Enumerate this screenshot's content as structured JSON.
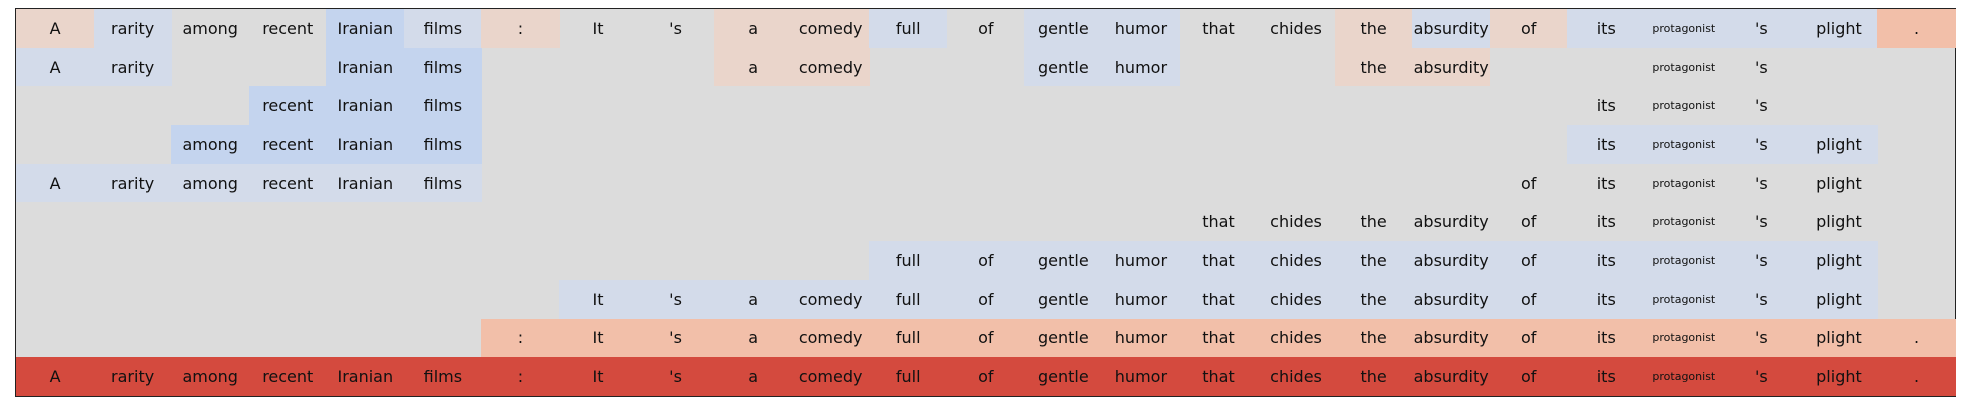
{
  "chart_data": {
    "type": "heatmap",
    "colors": {
      "background": "#dcdcdc",
      "r": "#d44a3e",
      "o": "#f2bfa9",
      "p": "#ead5cb",
      "b": "#c4d4ee",
      "l": "#d3dbea"
    },
    "tokens": [
      "A",
      "rarity",
      "among",
      "recent",
      "Iranian",
      "films",
      ":",
      "It",
      "'s",
      "a",
      "comedy",
      "full",
      "of",
      "gentle",
      "humor",
      "that",
      "chides",
      "the",
      "absurdity",
      "of",
      "its",
      "protagonist",
      "'s",
      "plight",
      "."
    ],
    "rows": [
      {
        "words": [
          "A",
          "rarity",
          "among",
          "recent",
          "Iranian",
          "films",
          ":",
          "It",
          "'s",
          "a",
          "comedy",
          "full",
          "of",
          "gentle",
          "humor",
          "that",
          "chides",
          "the",
          "absurdity",
          "of",
          "its",
          "protagonist",
          "'s",
          "plight",
          "."
        ],
        "shades": [
          "p",
          "l",
          "",
          "",
          "b",
          "l",
          "p",
          "",
          "",
          "p",
          "p",
          "l",
          "",
          "l",
          "l",
          "",
          "",
          "p",
          "l",
          "p",
          "l",
          "l",
          "l",
          "l",
          "o"
        ]
      },
      {
        "words": [
          "A",
          "rarity",
          "",
          "",
          "Iranian",
          "films",
          "",
          "",
          "",
          "a",
          "comedy",
          "",
          "",
          "gentle",
          "humor",
          "",
          "",
          "the",
          "absurdity",
          "",
          "",
          "protagonist",
          "'s",
          "",
          ""
        ],
        "shades": [
          "l",
          "l",
          "",
          "",
          "b",
          "b",
          "",
          "",
          "",
          "p",
          "p",
          "",
          "",
          "l",
          "l",
          "",
          "",
          "p",
          "p",
          "",
          "",
          "",
          "",
          "",
          ""
        ]
      },
      {
        "words": [
          "",
          "",
          "",
          "recent",
          "Iranian",
          "films",
          "",
          "",
          "",
          "",
          "",
          "",
          "",
          "",
          "",
          "",
          "",
          "",
          "",
          "",
          "its",
          "protagonist",
          "'s",
          "",
          ""
        ],
        "shades": [
          "",
          "",
          "",
          "b",
          "b",
          "b",
          "",
          "",
          "",
          "",
          "",
          "",
          "",
          "",
          "",
          "",
          "",
          "",
          "",
          "",
          "",
          "",
          "",
          "",
          ""
        ]
      },
      {
        "words": [
          "",
          "",
          "among",
          "recent",
          "Iranian",
          "films",
          "",
          "",
          "",
          "",
          "",
          "",
          "",
          "",
          "",
          "",
          "",
          "",
          "",
          "",
          "its",
          "protagonist",
          "'s",
          "plight",
          ""
        ],
        "shades": [
          "",
          "",
          "b",
          "b",
          "b",
          "b",
          "",
          "",
          "",
          "",
          "",
          "",
          "",
          "",
          "",
          "",
          "",
          "",
          "",
          "",
          "l",
          "l",
          "l",
          "l",
          ""
        ]
      },
      {
        "words": [
          "A",
          "rarity",
          "among",
          "recent",
          "Iranian",
          "films",
          "",
          "",
          "",
          "",
          "",
          "",
          "",
          "",
          "",
          "",
          "",
          "",
          "",
          "of",
          "its",
          "protagonist",
          "'s",
          "plight",
          ""
        ],
        "shades": [
          "l",
          "l",
          "l",
          "l",
          "l",
          "l",
          "",
          "",
          "",
          "",
          "",
          "",
          "",
          "",
          "",
          "",
          "",
          "",
          "",
          "",
          "",
          "",
          "",
          "",
          ""
        ]
      },
      {
        "words": [
          "",
          "",
          "",
          "",
          "",
          "",
          "",
          "",
          "",
          "",
          "",
          "",
          "",
          "",
          "",
          "that",
          "chides",
          "the",
          "absurdity",
          "of",
          "its",
          "protagonist",
          "'s",
          "plight",
          ""
        ],
        "shades": [
          "",
          "",
          "",
          "",
          "",
          "",
          "",
          "",
          "",
          "",
          "",
          "",
          "",
          "",
          "",
          "",
          "",
          "",
          "",
          "",
          "",
          "",
          "",
          "",
          ""
        ]
      },
      {
        "words": [
          "",
          "",
          "",
          "",
          "",
          "",
          "",
          "",
          "",
          "",
          "",
          "full",
          "of",
          "gentle",
          "humor",
          "that",
          "chides",
          "the",
          "absurdity",
          "of",
          "its",
          "protagonist",
          "'s",
          "plight",
          ""
        ],
        "shades": [
          "",
          "",
          "",
          "",
          "",
          "",
          "",
          "",
          "",
          "",
          "",
          "l",
          "l",
          "l",
          "l",
          "l",
          "l",
          "l",
          "l",
          "l",
          "l",
          "l",
          "l",
          "l",
          ""
        ]
      },
      {
        "words": [
          "",
          "",
          "",
          "",
          "",
          "",
          "",
          "It",
          "'s",
          "a",
          "comedy",
          "full",
          "of",
          "gentle",
          "humor",
          "that",
          "chides",
          "the",
          "absurdity",
          "of",
          "its",
          "protagonist",
          "'s",
          "plight",
          ""
        ],
        "shades": [
          "",
          "",
          "",
          "",
          "",
          "",
          "",
          "l",
          "l",
          "l",
          "l",
          "l",
          "l",
          "l",
          "l",
          "l",
          "l",
          "l",
          "l",
          "l",
          "l",
          "l",
          "l",
          "l",
          ""
        ]
      },
      {
        "words": [
          "",
          "",
          "",
          "",
          "",
          "",
          ":",
          "It",
          "'s",
          "a",
          "comedy",
          "full",
          "of",
          "gentle",
          "humor",
          "that",
          "chides",
          "the",
          "absurdity",
          "of",
          "its",
          "protagonist",
          "'s",
          "plight",
          "."
        ],
        "shades": [
          "",
          "",
          "",
          "",
          "",
          "",
          "o",
          "o",
          "o",
          "o",
          "o",
          "o",
          "o",
          "o",
          "o",
          "o",
          "o",
          "o",
          "o",
          "o",
          "o",
          "o",
          "o",
          "o",
          "o"
        ]
      },
      {
        "words": [
          "A",
          "rarity",
          "among",
          "recent",
          "Iranian",
          "films",
          ":",
          "It",
          "'s",
          "a",
          "comedy",
          "full",
          "of",
          "gentle",
          "humor",
          "that",
          "chides",
          "the",
          "absurdity",
          "of",
          "its",
          "protagonist",
          "'s",
          "plight",
          "."
        ],
        "shades": [
          "r",
          "r",
          "r",
          "r",
          "r",
          "r",
          "r",
          "r",
          "r",
          "r",
          "r",
          "r",
          "r",
          "r",
          "r",
          "r",
          "r",
          "r",
          "r",
          "r",
          "r",
          "r",
          "r",
          "r",
          "r"
        ]
      }
    ]
  }
}
